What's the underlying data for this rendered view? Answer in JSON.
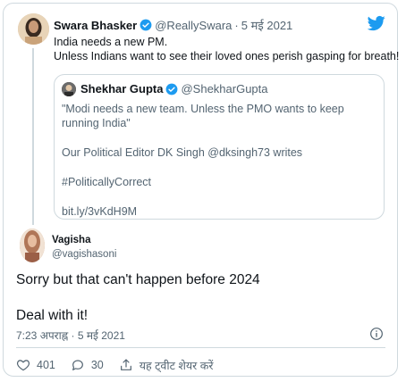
{
  "parent": {
    "name": "Swara Bhasker",
    "handle": "@ReallySwara",
    "dot": "·",
    "date": "5 मई 2021",
    "line1": "India needs a new PM.",
    "line2": "Unless Indians want to see their loved ones perish gasping for breath!"
  },
  "quote": {
    "name": "Shekhar Gupta",
    "handle": "@ShekharGupta",
    "line1": "\"Modi needs a new team. Unless the PMO wants to keep running India\"",
    "line2": "Our Political Editor DK Singh @dksingh73 writes",
    "line3": "#PoliticallyCorrect",
    "line4": "bit.ly/3vKdH9M"
  },
  "reply": {
    "name": "Vagisha",
    "handle": "@vagishasoni",
    "line1": "Sorry but that can't happen before 2024",
    "line2": "Deal with it!",
    "timestamp": "7:23 अपराह्न · 5 मई 2021"
  },
  "actions": {
    "likes": "401",
    "replies": "30",
    "share": "यह ट्वीट शेयर करें"
  },
  "colors": {
    "twitter_blue": "#1d9bf0",
    "muted": "#536471",
    "border": "#cfd9de"
  },
  "icons": [
    "twitter-bird-icon",
    "verified-badge-icon",
    "info-icon",
    "heart-icon",
    "reply-icon",
    "share-icon"
  ]
}
